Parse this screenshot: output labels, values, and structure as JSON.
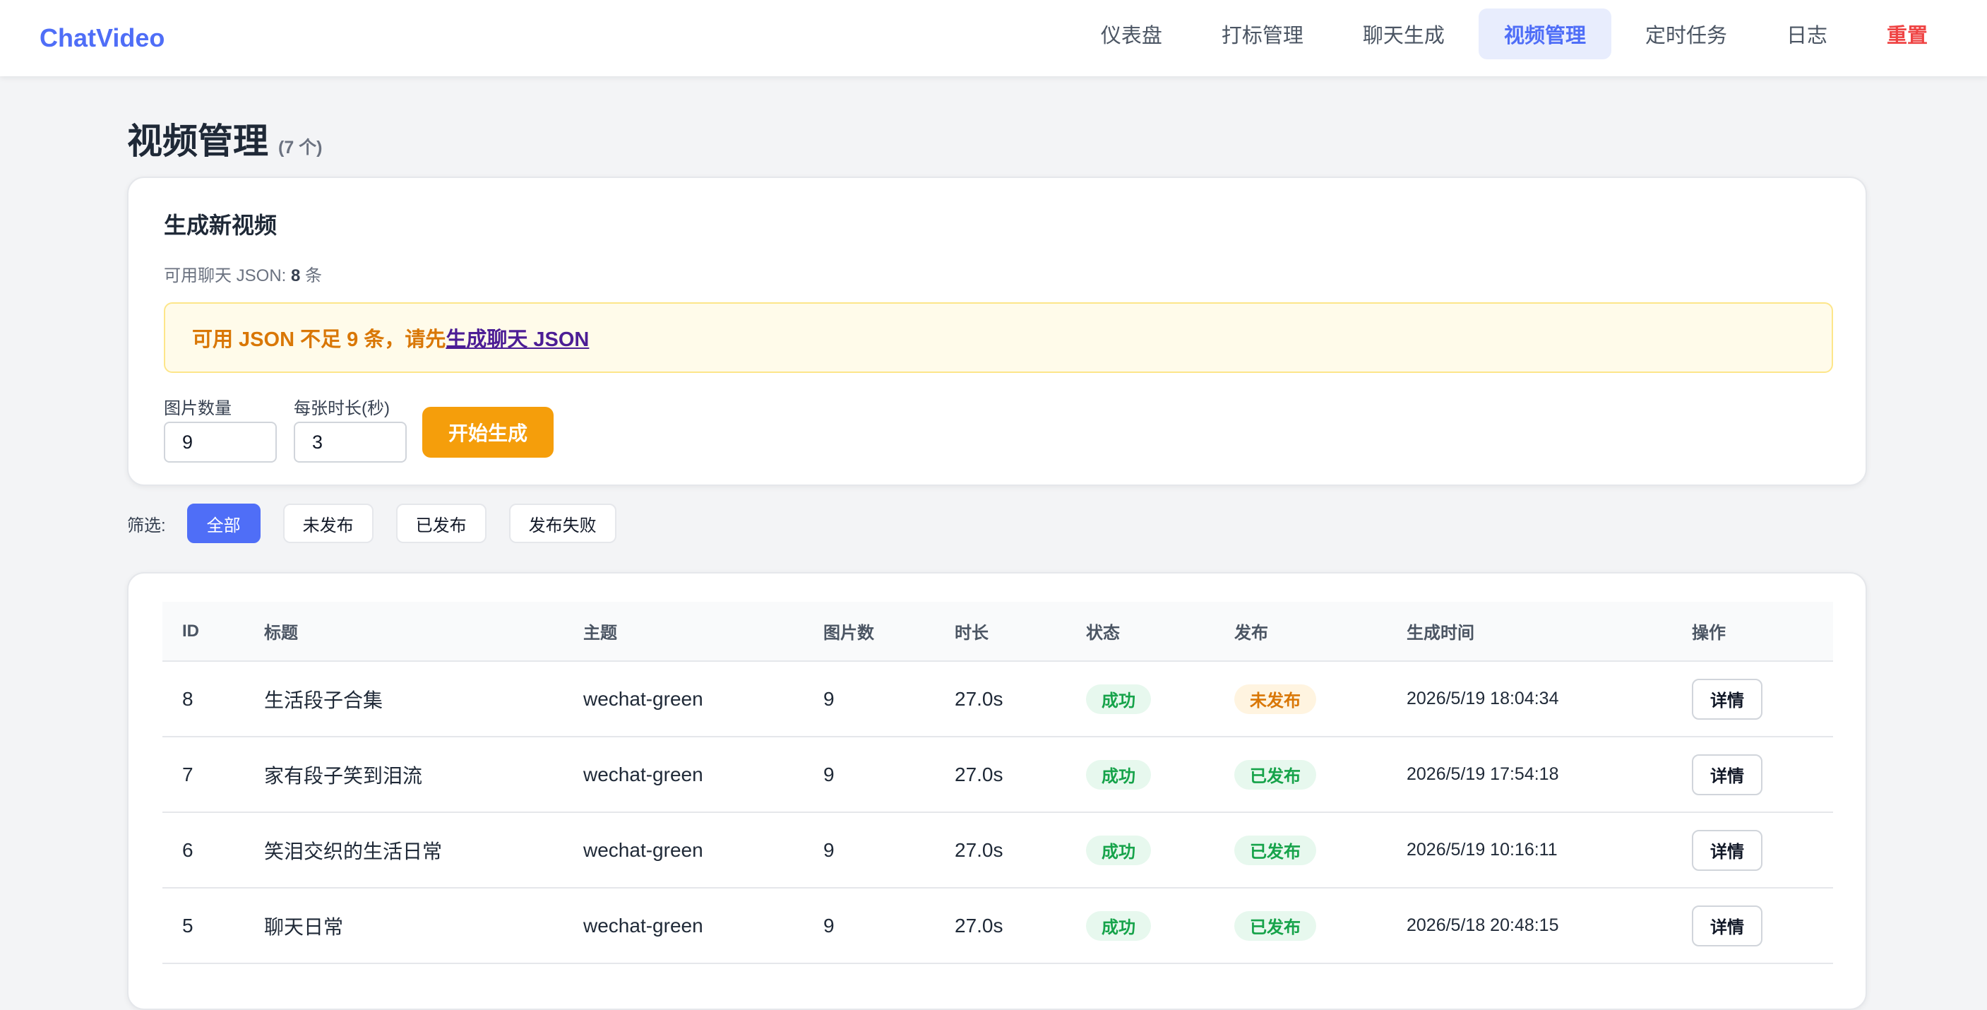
{
  "nav": {
    "brand": "ChatVideo",
    "items": [
      "仪表盘",
      "打标管理",
      "聊天生成",
      "视频管理",
      "定时任务",
      "日志",
      "重置"
    ],
    "active_index": 3,
    "danger_index": 6
  },
  "page": {
    "title": "视频管理",
    "count": "(7 个)"
  },
  "generate": {
    "title": "生成新视频",
    "avail_label": "可用聊天 JSON:",
    "avail_count": "8",
    "avail_unit": "条",
    "warning_text": "可用 JSON 不足 9 条，请先",
    "warning_link": "生成聊天 JSON",
    "image_count_label": "图片数量",
    "image_count_value": "9",
    "duration_label": "每张时长(秒)",
    "duration_value": "3",
    "start_button": "开始生成"
  },
  "filter": {
    "label": "筛选:",
    "options": [
      "全部",
      "未发布",
      "已发布",
      "发布失败"
    ],
    "active_index": 0
  },
  "table": {
    "headers": [
      "ID",
      "标题",
      "主题",
      "图片数",
      "时长",
      "状态",
      "发布",
      "生成时间",
      "操作"
    ],
    "rows": [
      {
        "id": "8",
        "title": "生活段子合集",
        "theme": "wechat-green",
        "images": "9",
        "duration": "27.0s",
        "status": "成功",
        "publish": "未发布",
        "time": "2026/5/19 18:04:34",
        "action": "详情"
      },
      {
        "id": "7",
        "title": "家有段子笑到泪流",
        "theme": "wechat-green",
        "images": "9",
        "duration": "27.0s",
        "status": "成功",
        "publish": "已发布",
        "time": "2026/5/19 17:54:18",
        "action": "详情"
      },
      {
        "id": "6",
        "title": "笑泪交织的生活日常",
        "theme": "wechat-green",
        "images": "9",
        "duration": "27.0s",
        "status": "成功",
        "publish": "已发布",
        "time": "2026/5/19 10:16:11",
        "action": "详情"
      },
      {
        "id": "5",
        "title": "聊天日常",
        "theme": "wechat-green",
        "images": "9",
        "duration": "27.0s",
        "status": "成功",
        "publish": "已发布",
        "time": "2026/5/18 20:48:15",
        "action": "详情"
      }
    ]
  },
  "colors": {
    "accent": "#4f6ef7",
    "warning_bg": "#fffbea",
    "start_button": "#f59e0b",
    "success": "#16a34a",
    "unpublished": "#d97706",
    "danger": "#ef4444"
  }
}
